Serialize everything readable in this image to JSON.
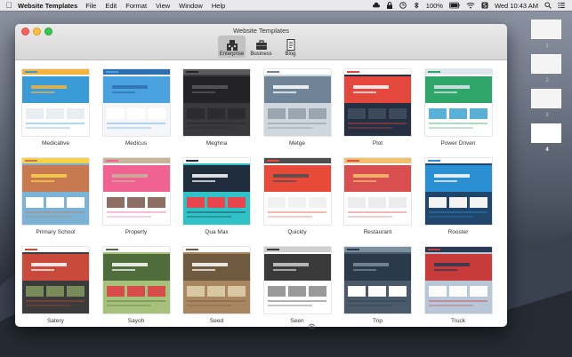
{
  "menubar": {
    "app_name": "Website Templates",
    "menus": [
      "File",
      "Edit",
      "Format",
      "View",
      "Window",
      "Help"
    ],
    "battery": "100%",
    "clock": "Wed 10:43 AM"
  },
  "window": {
    "title": "Website Templates",
    "toolbar": [
      {
        "label": "Enterprise",
        "icon": "building-icon",
        "selected": true
      },
      {
        "label": "Business",
        "icon": "briefcase-icon",
        "selected": false
      },
      {
        "label": "Blog",
        "icon": "document-icon",
        "selected": false
      }
    ]
  },
  "templates": [
    {
      "name": "Medicative",
      "colors": [
        "#ffffff",
        "#3a9bd6",
        "#f3b33d",
        "#e9eef3"
      ]
    },
    {
      "name": "Medicus",
      "colors": [
        "#f4f6f9",
        "#4aa3df",
        "#2e6fb0",
        "#ffffff"
      ]
    },
    {
      "name": "Meghna",
      "colors": [
        "#3a3a3c",
        "#232325",
        "#5b5b5d",
        "#2c2c2e"
      ]
    },
    {
      "name": "Metge",
      "colors": [
        "#cfd6dc",
        "#6f8496",
        "#ffffff",
        "#9aa6b0"
      ]
    },
    {
      "name": "Plot",
      "colors": [
        "#243042",
        "#e4473c",
        "#ffffff",
        "#3d4a5c"
      ]
    },
    {
      "name": "Power Driven",
      "colors": [
        "#ffffff",
        "#2fa56a",
        "#dfe7ee",
        "#5ab1d6"
      ]
    },
    {
      "name": "Primary School",
      "colors": [
        "#7ab3d6",
        "#c9794f",
        "#f6d24b",
        "#ffffff"
      ]
    },
    {
      "name": "Property",
      "colors": [
        "#ffffff",
        "#f06292",
        "#c7b49a",
        "#8d6e63"
      ]
    },
    {
      "name": "Qua Max",
      "colors": [
        "#2ec1c6",
        "#1f2d3d",
        "#ffffff",
        "#e8454d"
      ]
    },
    {
      "name": "Quickly",
      "colors": [
        "#ffffff",
        "#e84a3a",
        "#4e4e4e",
        "#f1f1f1"
      ]
    },
    {
      "name": "Restaurant",
      "colors": [
        "#ffffff",
        "#d94f4f",
        "#f2c06d",
        "#ececec"
      ]
    },
    {
      "name": "Rooster",
      "colors": [
        "#20476b",
        "#2b8fd4",
        "#ffffff",
        "#f4f4f4"
      ]
    },
    {
      "name": "Satery",
      "colors": [
        "#3b3b3b",
        "#c94a3a",
        "#ffffff",
        "#7a8a5a"
      ]
    },
    {
      "name": "Sayoh",
      "colors": [
        "#a6c27a",
        "#4f6d3a",
        "#ffffff",
        "#d84b4b"
      ]
    },
    {
      "name": "Seed",
      "colors": [
        "#a88660",
        "#6f5a40",
        "#ffffff",
        "#d8c7a3"
      ]
    },
    {
      "name": "Seen",
      "colors": [
        "#ffffff",
        "#3a3a3a",
        "#cfcfcf",
        "#9a9a9a"
      ]
    },
    {
      "name": "Trip",
      "colors": [
        "#4a5a6a",
        "#2a3a4a",
        "#7b8f9f",
        "#ffffff"
      ]
    },
    {
      "name": "Truck",
      "colors": [
        "#b9c6d8",
        "#c73b3b",
        "#2a3a55",
        "#ffffff"
      ]
    }
  ],
  "spaces": [
    {
      "label": "1",
      "active": false
    },
    {
      "label": "2",
      "active": false
    },
    {
      "label": "3",
      "active": false
    },
    {
      "label": "4",
      "active": true
    }
  ]
}
